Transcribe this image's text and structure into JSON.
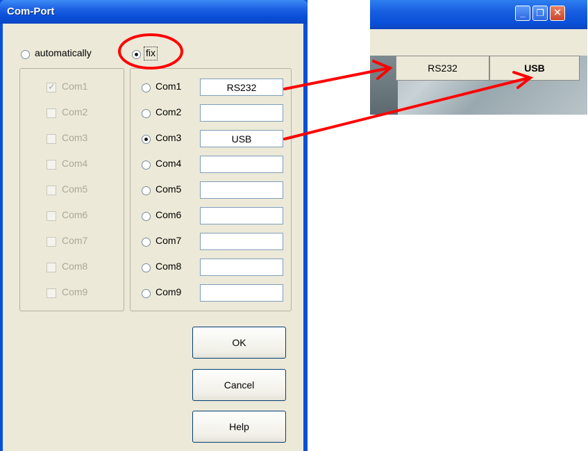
{
  "dialog": {
    "title": "Com-Port",
    "mode": {
      "automatically_label": "automatically",
      "fix_label": "fix",
      "selected": "fix"
    },
    "auto_ports": [
      {
        "label": "Com1",
        "checked": true
      },
      {
        "label": "Com2",
        "checked": false
      },
      {
        "label": "Com3",
        "checked": false
      },
      {
        "label": "Com4",
        "checked": false
      },
      {
        "label": "Com5",
        "checked": false
      },
      {
        "label": "Com6",
        "checked": false
      },
      {
        "label": "Com7",
        "checked": false
      },
      {
        "label": "Com8",
        "checked": false
      },
      {
        "label": "Com9",
        "checked": false
      }
    ],
    "fix_ports": [
      {
        "label": "Com1",
        "value": "RS232",
        "selected": false
      },
      {
        "label": "Com2",
        "value": "",
        "selected": false
      },
      {
        "label": "Com3",
        "value": "USB",
        "selected": true
      },
      {
        "label": "Com4",
        "value": "",
        "selected": false
      },
      {
        "label": "Com5",
        "value": "",
        "selected": false
      },
      {
        "label": "Com6",
        "value": "",
        "selected": false
      },
      {
        "label": "Com7",
        "value": "",
        "selected": false
      },
      {
        "label": "Com8",
        "value": "",
        "selected": false
      },
      {
        "label": "Com9",
        "value": "",
        "selected": false
      }
    ],
    "buttons": {
      "ok": "OK",
      "cancel": "Cancel",
      "help": "Help"
    }
  },
  "app_window": {
    "caption_buttons": {
      "minimize": "_",
      "restore": "❐",
      "close": "✕"
    },
    "port_buttons": {
      "rs232": "RS232",
      "usb": "USB"
    }
  },
  "colors": {
    "title_blue": "#0a4fd8",
    "dialog_face": "#ece9d8",
    "annotation_red": "#ff0000"
  }
}
